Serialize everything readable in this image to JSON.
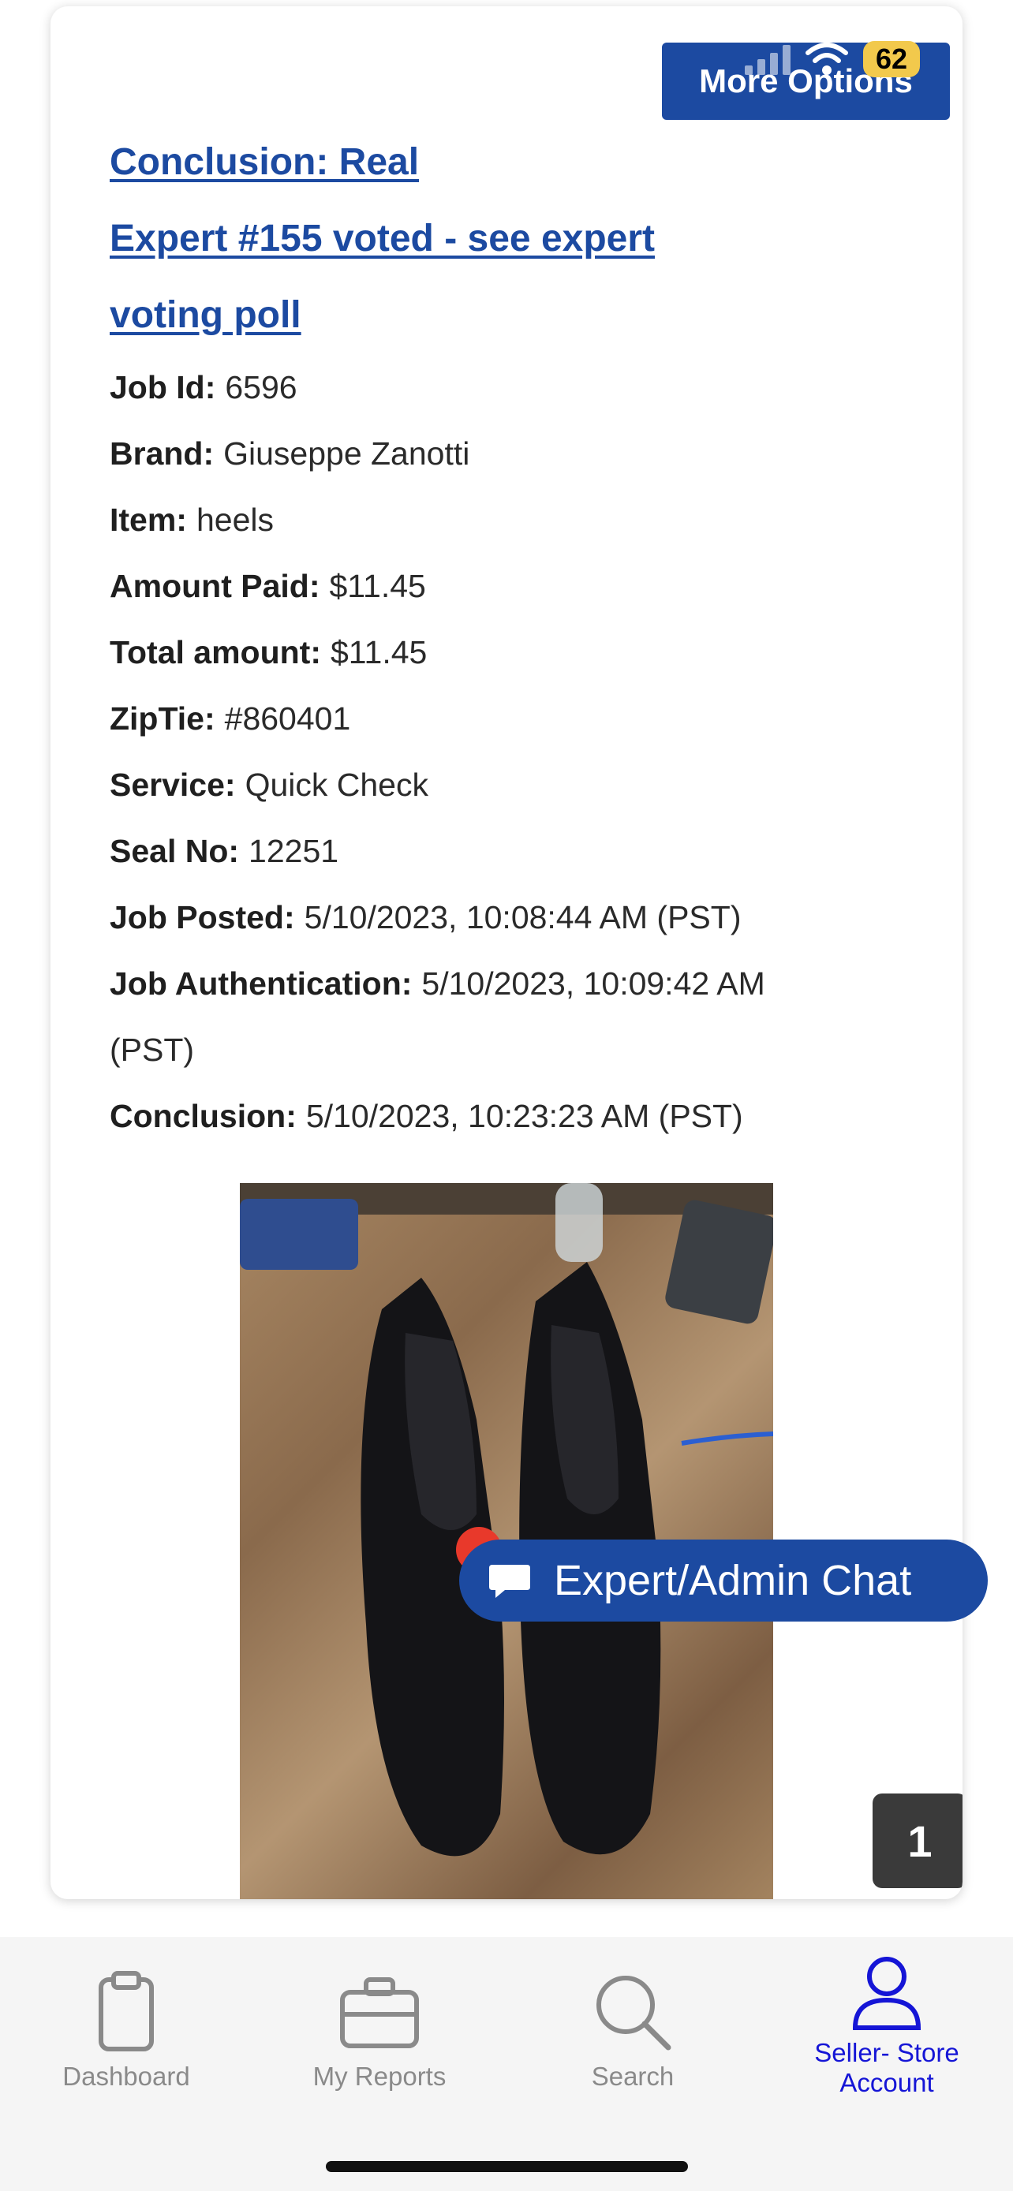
{
  "header": {
    "more_options_label": "More Options",
    "battery_level": "62"
  },
  "links": {
    "conclusion": "Conclusion: Real",
    "voting_line1": "Expert #155 voted - see expert",
    "voting_line2": "voting poll"
  },
  "details": {
    "job_id_label": "Job Id:",
    "job_id": "6596",
    "brand_label": "Brand:",
    "brand": "Giuseppe Zanotti",
    "item_label": "Item:",
    "item": "heels",
    "amount_paid_label": "Amount Paid:",
    "amount_paid": "$11.45",
    "total_label": "Total amount:",
    "total": "$11.45",
    "ziptie_label": "ZipTie:",
    "ziptie": "#860401",
    "service_label": "Service:",
    "service": "Quick Check",
    "seal_label": "Seal No:",
    "seal": "12251",
    "posted_label": "Job Posted:",
    "posted": "5/10/2023, 10:08:44 AM (PST)",
    "auth_label": "Job Authentication:",
    "auth_line1": "5/10/2023, 10:09:42 AM",
    "auth_line2": "(PST)",
    "conclusion_label": "Conclusion:",
    "conclusion": "5/10/2023, 10:23:23 AM (PST)"
  },
  "chat": {
    "label": "Expert/Admin Chat"
  },
  "photo_counter": "1",
  "tabbar": {
    "items": [
      {
        "label": "Dashboard",
        "icon": "clipboard-icon"
      },
      {
        "label": "My Reports",
        "icon": "briefcase-icon"
      },
      {
        "label": "Search",
        "icon": "search-icon"
      },
      {
        "label_line1": "Seller- Store",
        "label_line2": "Account",
        "icon": "user-icon"
      }
    ],
    "active_color": "#1515d6",
    "inactive_color": "#8a8a8a"
  },
  "colors": {
    "accent": "#1c4aa1",
    "chat_dot": "#e8392b"
  }
}
